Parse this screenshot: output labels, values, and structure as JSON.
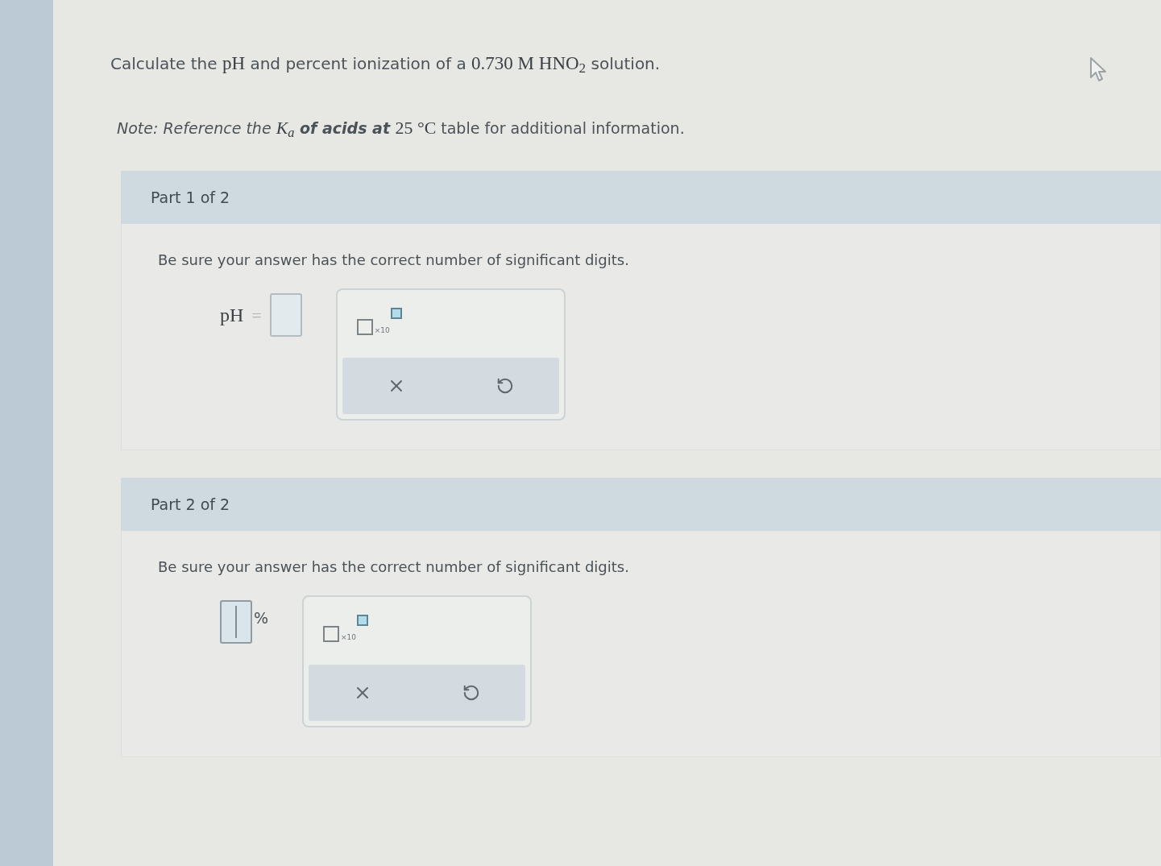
{
  "question": {
    "segments": [
      {
        "kind": "plain",
        "text": "Calculate the "
      },
      {
        "kind": "math",
        "text": "pH"
      },
      {
        "kind": "plain",
        "text": " and percent ionization of a "
      },
      {
        "kind": "math",
        "text": "0.730 M HNO$_{2}$"
      },
      {
        "kind": "plain",
        "text": " solution."
      }
    ]
  },
  "note": {
    "segments": [
      {
        "kind": "italic",
        "text": "Note: Reference the "
      },
      {
        "kind": "variable",
        "text": "K$_{a}$"
      },
      {
        "kind": "bold_italic",
        "text": " of acids at "
      },
      {
        "kind": "math",
        "text": "25 °C"
      },
      {
        "kind": "plain",
        "text": " table for additional information."
      }
    ]
  },
  "parts": [
    {
      "header": "Part 1 of 2",
      "instruction": "Be sure your answer has the correct number of significant digits.",
      "answer": {
        "kind": "prefix",
        "label": "pH",
        "relation": "=",
        "focused": false
      },
      "tools": {
        "exponent_label": "×10"
      }
    },
    {
      "header": "Part 2 of 2",
      "instruction": "Be sure your answer has the correct number of significant digits.",
      "answer": {
        "kind": "suffix",
        "unit": "%",
        "focused": true
      },
      "tools": {
        "exponent_label": "×10"
      }
    }
  ]
}
